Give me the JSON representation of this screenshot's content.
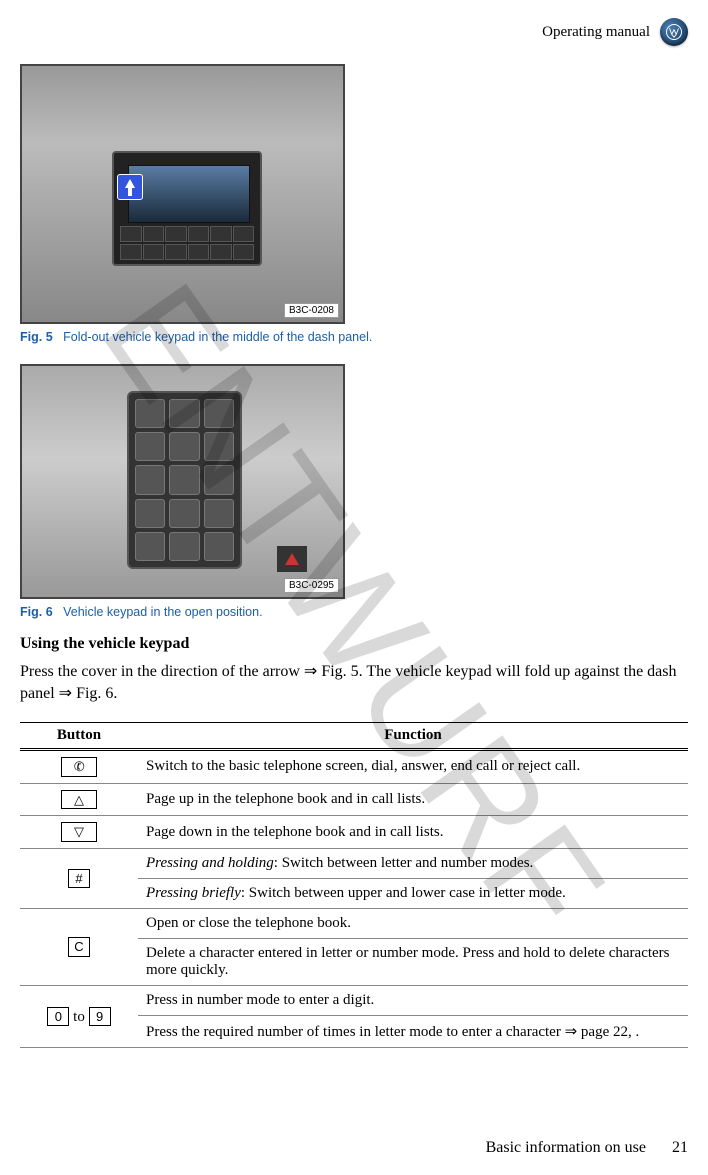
{
  "header": {
    "title": "Operating manual"
  },
  "watermark": "ENTWURF",
  "figures": {
    "fig5": {
      "label": "Fig. 5",
      "caption": "Fold-out vehicle keypad in the middle of the dash panel.",
      "imgcode": "B3C-0208"
    },
    "fig6": {
      "label": "Fig. 6",
      "caption": "Vehicle keypad in the open position.",
      "imgcode": "B3C-0295"
    }
  },
  "section": {
    "title": "Using the vehicle keypad",
    "body_a": "Press the cover in the direction of the arrow ",
    "body_b": " Fig. 5. The vehicle keypad will fold up against the dash panel ",
    "body_c": " Fig. 6."
  },
  "table": {
    "head": {
      "button": "Button",
      "function": "Function"
    },
    "rows": [
      {
        "key": "phone",
        "key_glyph": "✆",
        "fns": [
          "Switch to the basic telephone screen, dial, answer, end call or reject call."
        ]
      },
      {
        "key": "up",
        "key_glyph": "△",
        "fns": [
          "Page up in the telephone book and in call lists."
        ]
      },
      {
        "key": "down",
        "key_glyph": "▽",
        "fns": [
          "Page down in the telephone book and in call lists."
        ]
      },
      {
        "key": "hash",
        "key_glyph": "#",
        "fns": [
          {
            "em": "Pressing and holding",
            "txt": ": Switch between letter and number modes."
          },
          {
            "em": "Pressing briefly",
            "txt": ": Switch between upper and lower case in letter mode."
          }
        ]
      },
      {
        "key": "c",
        "key_glyph": "C",
        "fns": [
          "Open or close the telephone book.",
          "Delete a character entered in letter or number mode. Press and hold to delete characters more quickly."
        ]
      },
      {
        "key": "digits",
        "key_a": "0",
        "key_mid": " to ",
        "key_b": "9",
        "fns": [
          "Press in number mode to enter a digit.",
          {
            "txt_a": "Press the required number of times in letter mode to enter a character ",
            "txt_b": " page 22, ."
          }
        ]
      }
    ]
  },
  "footer": {
    "section": "Basic information on use",
    "page": "21"
  }
}
